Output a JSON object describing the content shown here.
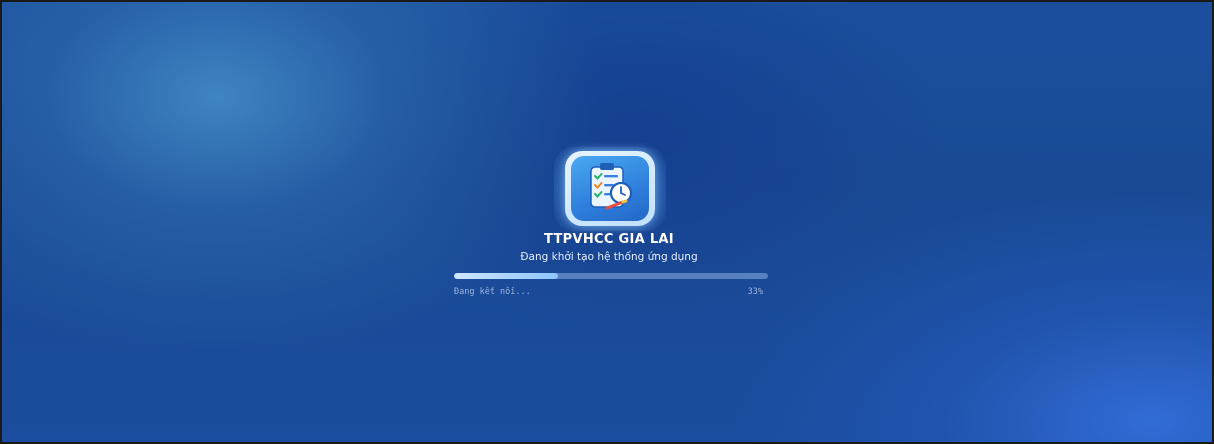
{
  "app": {
    "title": "TTPVHCC GIA LAI",
    "subtitle": "Đang khởi tạo hệ thống ứng dụng",
    "logo_icon": "clipboard-checklist-clock-icon"
  },
  "loading": {
    "status": "Đang kết nối...",
    "percent_label": "33%",
    "progress": 0.33
  },
  "colors": {
    "background": "#1b4f9e",
    "progress_fill": "#8cc6ff",
    "progress_track": "#5e86c4",
    "title": "#ffffff"
  }
}
